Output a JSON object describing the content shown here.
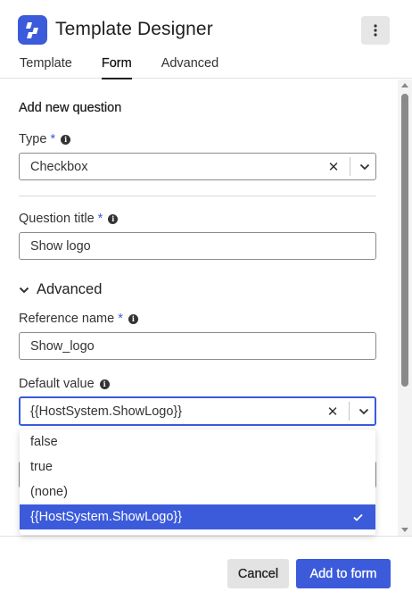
{
  "app": {
    "title": "Template Designer",
    "accent": "#3b5bdb"
  },
  "tabs": [
    {
      "label": "Template",
      "active": false
    },
    {
      "label": "Form",
      "active": true
    },
    {
      "label": "Advanced",
      "active": false
    }
  ],
  "form": {
    "section_title": "Add new question",
    "type": {
      "label": "Type",
      "required_mark": "*",
      "value": "Checkbox"
    },
    "question_title": {
      "label": "Question title",
      "required_mark": "*",
      "value": "Show logo"
    },
    "advanced_toggle": "Advanced",
    "reference_name": {
      "label": "Reference name",
      "required_mark": "*",
      "value": "Show_logo"
    },
    "default_value": {
      "label": "Default value",
      "value": "{{HostSystem.ShowLogo}}"
    }
  },
  "dropdown": {
    "options": [
      "false",
      "true",
      "(none)",
      "{{HostSystem.ShowLogo}}"
    ],
    "selected": "{{HostSystem.ShowLogo}}"
  },
  "footer": {
    "cancel_label": "Cancel",
    "submit_label": "Add to form"
  },
  "icons": {
    "menu": "kebab-menu-icon",
    "info": "info-icon",
    "clear": "clear-icon",
    "chevron": "chevron-down-icon",
    "check": "checkmark-icon"
  }
}
